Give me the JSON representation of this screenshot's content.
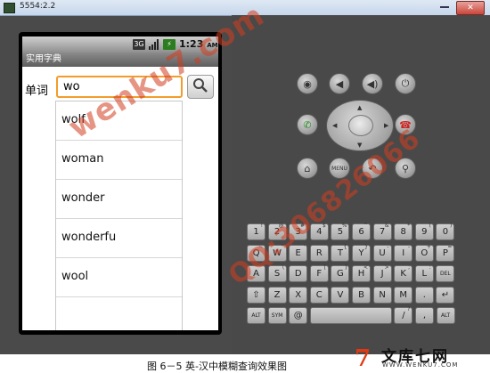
{
  "window": {
    "title": "5554:2.2"
  },
  "statusbar": {
    "signal_3g": "3G",
    "time": "1:23",
    "ampm": "AM"
  },
  "app": {
    "title": "实用字典"
  },
  "search": {
    "label": "单词",
    "value": "wo"
  },
  "suggestions": [
    "wolf",
    "woman",
    "wonder",
    "wonderfu",
    "wool"
  ],
  "controls": {
    "icons": [
      "camera-icon",
      "volume-down-icon",
      "volume-up-icon",
      "power-icon",
      "call-icon",
      "end-call-icon",
      "home-icon",
      "menu-icon",
      "back-icon",
      "search-icon"
    ],
    "menu_label": "MENU"
  },
  "keyboard": {
    "row1": [
      {
        "k": "1",
        "s": "!"
      },
      {
        "k": "2",
        "s": "@"
      },
      {
        "k": "3",
        "s": "#"
      },
      {
        "k": "4",
        "s": "$"
      },
      {
        "k": "5",
        "s": "%"
      },
      {
        "k": "6",
        "s": "^"
      },
      {
        "k": "7",
        "s": "&"
      },
      {
        "k": "8",
        "s": "*"
      },
      {
        "k": "9",
        "s": "("
      },
      {
        "k": "0",
        "s": ")"
      }
    ],
    "row2": [
      {
        "k": "Q",
        "s": "~"
      },
      {
        "k": "W",
        "s": "\""
      },
      {
        "k": "E",
        "s": "'"
      },
      {
        "k": "R",
        "s": ""
      },
      {
        "k": "T",
        "s": "{"
      },
      {
        "k": "Y",
        "s": "}"
      },
      {
        "k": "U",
        "s": "-"
      },
      {
        "k": "I",
        "s": "-"
      },
      {
        "k": "O",
        "s": "+"
      },
      {
        "k": "P",
        "s": "="
      }
    ],
    "row3": [
      {
        "k": "A",
        "s": ""
      },
      {
        "k": "S",
        "s": "\\"
      },
      {
        "k": "D",
        "s": ""
      },
      {
        "k": "F",
        "s": "["
      },
      {
        "k": "G",
        "s": "]"
      },
      {
        "k": "H",
        "s": "<"
      },
      {
        "k": "J",
        "s": ">"
      },
      {
        "k": "K",
        "s": ";"
      },
      {
        "k": "L",
        "s": ":"
      },
      {
        "k": "DEL",
        "s": ""
      }
    ],
    "row4": [
      {
        "k": "⇧",
        "s": ""
      },
      {
        "k": "Z",
        "s": ""
      },
      {
        "k": "X",
        "s": ""
      },
      {
        "k": "C",
        "s": ""
      },
      {
        "k": "V",
        "s": ""
      },
      {
        "k": "B",
        "s": ""
      },
      {
        "k": "N",
        "s": ""
      },
      {
        "k": "M",
        "s": ""
      },
      {
        "k": ".",
        "s": ""
      },
      {
        "k": "↵",
        "s": ""
      }
    ],
    "row5": [
      {
        "k": "ALT",
        "s": ""
      },
      {
        "k": "SYM",
        "s": ""
      },
      {
        "k": "@",
        "s": ""
      },
      {
        "k": "",
        "s": ""
      },
      {
        "k": "/",
        "s": "?"
      },
      {
        "k": ",",
        "s": ""
      },
      {
        "k": "ALT",
        "s": ""
      }
    ]
  },
  "watermarks": {
    "site": "wenku7.com",
    "qq": "QQ:306826066"
  },
  "caption": {
    "text": "图 6－5 英-汉中模糊查询效果图"
  },
  "logo": {
    "mark": "7",
    "name": "文库七网",
    "url": "WWW.WENKU7.COM"
  }
}
